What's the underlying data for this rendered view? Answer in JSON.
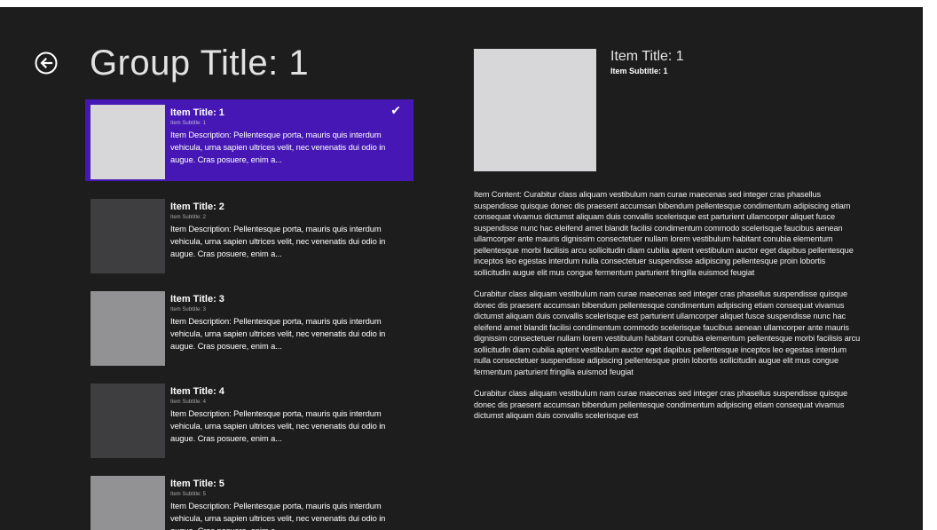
{
  "header": {
    "title": "Group Title: 1"
  },
  "colors": {
    "background": "#1d1d1d",
    "selected": "#4617b4",
    "thumb_light": "#d7d7d9",
    "thumb_dark": "#3e3e40",
    "thumb_mid": "#929295"
  },
  "items": [
    {
      "title": "Item Title: 1",
      "subtitle": "Item Subtitle: 1",
      "description": "Item Description: Pellentesque porta, mauris quis interdum vehicula, urna sapien ultrices velit, nec venenatis dui odio in augue. Cras posuere, enim a...",
      "selected": true
    },
    {
      "title": "Item Title: 2",
      "subtitle": "Item Subtitle: 2",
      "description": "Item Description: Pellentesque porta, mauris quis interdum vehicula, urna sapien ultrices velit, nec venenatis dui odio in augue. Cras posuere, enim a...",
      "selected": false
    },
    {
      "title": "Item Title: 3",
      "subtitle": "Item Subtitle: 3",
      "description": "Item Description: Pellentesque porta, mauris quis interdum vehicula, urna sapien ultrices velit, nec venenatis dui odio in augue. Cras posuere, enim a...",
      "selected": false
    },
    {
      "title": "Item Title: 4",
      "subtitle": "Item Subtitle: 4",
      "description": "Item Description: Pellentesque porta, mauris quis interdum vehicula, urna sapien ultrices velit, nec venenatis dui odio in augue. Cras posuere, enim a...",
      "selected": false
    },
    {
      "title": "Item Title: 5",
      "subtitle": "Item Subtitle: 5",
      "description": "Item Description: Pellentesque porta, mauris quis interdum vehicula, urna sapien ultrices velit, nec venenatis dui odio in augue. Cras posuere, enim a...",
      "selected": false
    }
  ],
  "detail": {
    "title": "Item Title: 1",
    "subtitle": "Item Subtitle: 1",
    "paragraphs": [
      "Item Content: Curabitur class aliquam vestibulum nam curae maecenas sed integer cras phasellus suspendisse quisque donec dis praesent accumsan bibendum pellentesque condimentum adipiscing etiam consequat vivamus dictumst aliquam duis convallis scelerisque est parturient ullamcorper aliquet fusce suspendisse nunc hac eleifend amet blandit facilisi condimentum commodo scelerisque faucibus aenean ullamcorper ante mauris dignissim consectetuer nullam lorem vestibulum habitant conubia elementum pellentesque morbi facilisis arcu sollicitudin diam cubilia aptent vestibulum auctor eget dapibus pellentesque inceptos leo egestas interdum nulla consectetuer suspendisse adipiscing pellentesque proin lobortis sollicitudin augue elit mus congue fermentum parturient fringilla euismod feugiat",
      "Curabitur class aliquam vestibulum nam curae maecenas sed integer cras phasellus suspendisse quisque donec dis praesent accumsan bibendum pellentesque condimentum adipiscing etiam consequat vivamus dictumst aliquam duis convallis scelerisque est parturient ullamcorper aliquet fusce suspendisse nunc hac eleifend amet blandit facilisi condimentum commodo scelerisque faucibus aenean ullamcorper ante mauris dignissim consectetuer nullam lorem vestibulum habitant conubia elementum pellentesque morbi facilisis arcu sollicitudin diam cubilia aptent vestibulum auctor eget dapibus pellentesque inceptos leo egestas interdum nulla consectetuer suspendisse adipiscing pellentesque proin lobortis sollicitudin augue elit mus congue fermentum parturient fringilla euismod feugiat",
      "Curabitur class aliquam vestibulum nam curae maecenas sed integer cras phasellus suspendisse quisque donec dis praesent accumsan bibendum pellentesque condimentum adipiscing etiam consequat vivamus dictumst aliquam duis convallis scelerisque est"
    ]
  }
}
